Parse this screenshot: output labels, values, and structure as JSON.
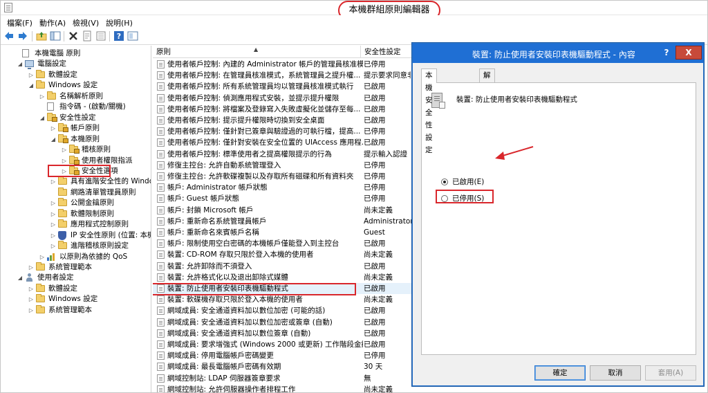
{
  "window": {
    "title": "本機群組原則編輯器"
  },
  "menu": {
    "items": [
      "檔案(F)",
      "動作(A)",
      "檢視(V)",
      "說明(H)"
    ]
  },
  "toolbar": {
    "icons": [
      "back-icon",
      "forward-icon",
      "up-folder-icon",
      "show-hide-tree-icon",
      "delete-icon",
      "properties-icon",
      "export-list-icon",
      "help-icon",
      "view-icon"
    ]
  },
  "tree": {
    "items": [
      {
        "label": "本機電腦 原則",
        "icon": "document"
      },
      {
        "label": "電腦設定",
        "icon": "computer"
      },
      {
        "label": "軟體設定",
        "icon": "folder"
      },
      {
        "label": "Windows 設定",
        "icon": "folder"
      },
      {
        "label": "名稱解析原則",
        "icon": "folder"
      },
      {
        "label": "指令碼 - (啟動/關機)",
        "icon": "document"
      },
      {
        "label": "安全性設定",
        "icon": "folder-lock"
      },
      {
        "label": "帳戶原則",
        "icon": "folder-lock"
      },
      {
        "label": "本機原則",
        "icon": "folder-lock"
      },
      {
        "label": "稽核原則",
        "icon": "folder-lock"
      },
      {
        "label": "使用者權限指派",
        "icon": "folder-lock"
      },
      {
        "label": "安全性選項",
        "icon": "folder-lock"
      },
      {
        "label": "具有進階安全性的 Windows",
        "icon": "folder"
      },
      {
        "label": "網路清單管理員原則",
        "icon": "folder"
      },
      {
        "label": "公開金鑰原則",
        "icon": "folder"
      },
      {
        "label": "軟體限制原則",
        "icon": "folder"
      },
      {
        "label": "應用程式控制原則",
        "icon": "folder"
      },
      {
        "label": "IP 安全性原則 (位置: 本機電腦",
        "icon": "shield"
      },
      {
        "label": "進階稽核原則設定",
        "icon": "folder"
      },
      {
        "label": "以原則為依據的 QoS",
        "icon": "bars"
      },
      {
        "label": "系統管理範本",
        "icon": "folder"
      },
      {
        "label": "使用者設定",
        "icon": "person"
      },
      {
        "label": "軟體設定",
        "icon": "folder"
      },
      {
        "label": "Windows 設定",
        "icon": "folder"
      },
      {
        "label": "系統管理範本",
        "icon": "folder"
      }
    ]
  },
  "list": {
    "columns": {
      "policy": "原則",
      "setting": "安全性設定"
    },
    "rows": [
      {
        "name": "使用者帳戶控制: 內建的 Administrator 帳戶的管理員核准模...",
        "value": "已停用"
      },
      {
        "name": "使用者帳戶控制: 在管理員核准模式，系統管理員之提升權...",
        "value": "提示要求同意非..."
      },
      {
        "name": "使用者帳戶控制: 所有系統管理員均以管理員核准模式執行",
        "value": "已啟用"
      },
      {
        "name": "使用者帳戶控制: 偵測應用程式安裝，並提示提升權限",
        "value": "已啟用"
      },
      {
        "name": "使用者帳戶控制: 將檔案及登錄寫入失敗虛擬化並儲存至每...",
        "value": "已啟用"
      },
      {
        "name": "使用者帳戶控制: 提示提升權限時切換到安全桌面",
        "value": "已啟用"
      },
      {
        "name": "使用者帳戶控制: 僅針對已簽章與驗證過的可執行檔，提高...",
        "value": "已停用"
      },
      {
        "name": "使用者帳戶控制: 僅針對安裝在安全位置的 UIAccess 應用程...",
        "value": "已啟用"
      },
      {
        "name": "使用者帳戶控制: 標準使用者之提高權限提示的行為",
        "value": "提示輸入認證"
      },
      {
        "name": "修復主控台: 允許自動系統管理登入",
        "value": "已停用"
      },
      {
        "name": "修復主控台: 允許軟碟複製以及存取所有磁碟和所有資料夾",
        "value": "已停用"
      },
      {
        "name": "帳戶: Administrator 帳戶狀態",
        "value": "已停用"
      },
      {
        "name": "帳戶: Guest 帳戶狀態",
        "value": "已停用"
      },
      {
        "name": "帳戶: 封鎖 Microsoft 帳戶",
        "value": "尚未定義"
      },
      {
        "name": "帳戶: 重新命名系統管理員帳戶",
        "value": "Administrator"
      },
      {
        "name": "帳戶: 重新命名來賓帳戶名稱",
        "value": "Guest"
      },
      {
        "name": "帳戶: 限制使用空白密碼的本機帳戶僅能登入到主控台",
        "value": "已啟用"
      },
      {
        "name": "裝置: CD-ROM 存取只限於登入本機的使用者",
        "value": "尚未定義"
      },
      {
        "name": "裝置: 允許卸除而不須登入",
        "value": "已啟用"
      },
      {
        "name": "裝置: 允許格式化以及退出卸除式媒體",
        "value": "尚未定義"
      },
      {
        "name": "裝置: 防止使用者安裝印表機驅動程式",
        "value": "已啟用"
      },
      {
        "name": "裝置: 軟碟機存取只限於登入本機的使用者",
        "value": "尚未定義"
      },
      {
        "name": "網域成員: 安全通道資料加以數位加密 (可能的話)",
        "value": "已啟用"
      },
      {
        "name": "網域成員: 安全通道資料加以數位加密或簽章 (自動)",
        "value": "已啟用"
      },
      {
        "name": "網域成員: 安全通道資料加以數位簽章 (自動)",
        "value": "已啟用"
      },
      {
        "name": "網域成員: 要求增強式 (Windows 2000 或更新) 工作階段金鑰",
        "value": "已啟用"
      },
      {
        "name": "網域成員: 停用電腦帳戶密碼變更",
        "value": "已停用"
      },
      {
        "name": "網域成員: 最長電腦帳戶密碼有效期",
        "value": "30 天"
      },
      {
        "name": "網域控制站: LDAP 伺服器簽章要求",
        "value": "無"
      },
      {
        "name": "網域控制站: 允許伺服器操作者排程工作",
        "value": "尚未定義"
      }
    ]
  },
  "dialog": {
    "title": "裝置: 防止使用者安裝印表機驅動程式 - 內容",
    "help_label": "?",
    "close_label": "X",
    "tabs": [
      "本機安全性設定",
      "解說"
    ],
    "policy_name": "裝置: 防止使用者安裝印表機驅動程式",
    "options": [
      {
        "label": "已啟用(E)",
        "selected": true
      },
      {
        "label": "已停用(S)",
        "selected": false
      }
    ],
    "buttons": {
      "ok": "確定",
      "cancel": "取消",
      "apply": "套用(A)"
    }
  },
  "colors": {
    "annotation_red": "#d9262b",
    "dialog_titlebar": "#1f6fd4",
    "close_button": "#c74a3a"
  }
}
